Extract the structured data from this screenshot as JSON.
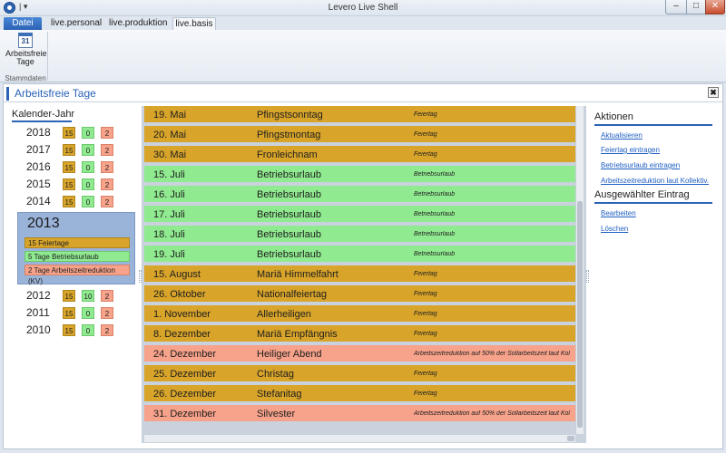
{
  "window": {
    "title": "Levero Live Shell",
    "qat_glyph": "| ▾",
    "min": "–",
    "max": "□",
    "close": "✕"
  },
  "ribbon": {
    "tabs": [
      "Datei",
      "live.personal",
      "live.produktion",
      "live.basis"
    ],
    "active_tab": "live.basis",
    "button_label_1": "Arbeitsfreie",
    "button_label_2": "Tage",
    "calendar_glyph": "31",
    "group_label": "Stammdaten"
  },
  "page": {
    "title": "Arbeitsfreie Tage",
    "close_glyph": "✖"
  },
  "years_panel": {
    "title": "Kalender-Jahr",
    "rows_before": [
      {
        "year": "2018",
        "feiertage": "15",
        "urlaub": "0",
        "reduktion": "2"
      },
      {
        "year": "2017",
        "feiertage": "15",
        "urlaub": "0",
        "reduktion": "2"
      },
      {
        "year": "2016",
        "feiertage": "15",
        "urlaub": "0",
        "reduktion": "2"
      },
      {
        "year": "2015",
        "feiertage": "15",
        "urlaub": "0",
        "reduktion": "2"
      },
      {
        "year": "2014",
        "feiertage": "15",
        "urlaub": "0",
        "reduktion": "2"
      }
    ],
    "selected": {
      "year": "2013",
      "feiertage_text": "15 Feiertage",
      "urlaub_text": "5 Tage Betriebsurlaub",
      "reduktion_text": "2 Tage Arbeitszeitreduktion (KV)"
    },
    "rows_after": [
      {
        "year": "2012",
        "feiertage": "15",
        "urlaub": "10",
        "reduktion": "2"
      },
      {
        "year": "2011",
        "feiertage": "15",
        "urlaub": "0",
        "reduktion": "2"
      },
      {
        "year": "2010",
        "feiertage": "15",
        "urlaub": "0",
        "reduktion": "2"
      }
    ]
  },
  "colors": {
    "feiertag": "#d8a42a",
    "betriebsurlaub": "#90ea90",
    "arbeitszeitreduktion": "#f7a28a",
    "accent": "#2c63b6"
  },
  "holidays": [
    {
      "date": "19. Mai",
      "name": "Pfingstsonntag",
      "type": "Feiertag",
      "kind": "feiertag"
    },
    {
      "date": "20. Mai",
      "name": "Pfingstmontag",
      "type": "Feiertag",
      "kind": "feiertag"
    },
    {
      "date": "30. Mai",
      "name": "Fronleichnam",
      "type": "Feiertag",
      "kind": "feiertag"
    },
    {
      "date": "15. Juli",
      "name": "Betriebsurlaub",
      "type": "Betriebsurlaub",
      "kind": "betriebsurlaub"
    },
    {
      "date": "16. Juli",
      "name": "Betriebsurlaub",
      "type": "Betriebsurlaub",
      "kind": "betriebsurlaub"
    },
    {
      "date": "17. Juli",
      "name": "Betriebsurlaub",
      "type": "Betriebsurlaub",
      "kind": "betriebsurlaub"
    },
    {
      "date": "18. Juli",
      "name": "Betriebsurlaub",
      "type": "Betriebsurlaub",
      "kind": "betriebsurlaub"
    },
    {
      "date": "19. Juli",
      "name": "Betriebsurlaub",
      "type": "Betriebsurlaub",
      "kind": "betriebsurlaub"
    },
    {
      "date": "15. August",
      "name": "Mariä Himmelfahrt",
      "type": "Feiertag",
      "kind": "feiertag"
    },
    {
      "date": "26. Oktober",
      "name": "Nationalfeiertag",
      "type": "Feiertag",
      "kind": "feiertag"
    },
    {
      "date": "1. November",
      "name": "Allerheiligen",
      "type": "Feiertag",
      "kind": "feiertag"
    },
    {
      "date": "8. Dezember",
      "name": "Mariä Empfängnis",
      "type": "Feiertag",
      "kind": "feiertag"
    },
    {
      "date": "24. Dezember",
      "name": "Heiliger Abend",
      "type": "Arbeitszeitreduktion auf 50% der Sollarbeitszeit laut Kol",
      "kind": "arbeitszeitreduktion"
    },
    {
      "date": "25. Dezember",
      "name": "Christag",
      "type": "Feiertag",
      "kind": "feiertag"
    },
    {
      "date": "26. Dezember",
      "name": "Stefanitag",
      "type": "Feiertag",
      "kind": "feiertag"
    },
    {
      "date": "31. Dezember",
      "name": "Silvester",
      "type": "Arbeitszeitreduktion auf 50% der Sollarbeitszeit laut Kol",
      "kind": "arbeitszeitreduktion"
    }
  ],
  "actions_panel": {
    "heading_actions": "Aktionen",
    "actions": [
      "Aktualisieren",
      "Feiertag eintragen",
      "Betriebsurlaub eintragen",
      "Arbeitszeitreduktion laut Kollektiv."
    ],
    "heading_selected": "Ausgewählter Eintrag",
    "selected_actions": [
      "Bearbeiten",
      "Löschen"
    ]
  }
}
